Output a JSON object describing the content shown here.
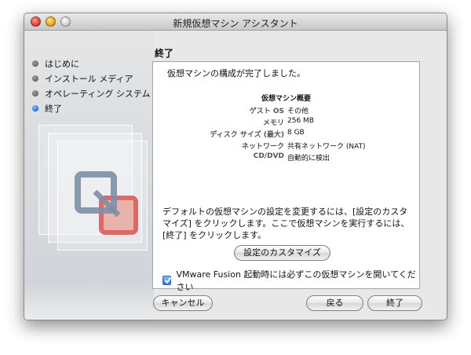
{
  "window": {
    "title": "新規仮想マシン アシスタント"
  },
  "steps": [
    {
      "label": "はじめに",
      "active": false
    },
    {
      "label": "インストール メディア",
      "active": false
    },
    {
      "label": "オペレーティング システム",
      "active": false
    },
    {
      "label": "終了",
      "active": true
    }
  ],
  "page": {
    "title": "終了"
  },
  "panel": {
    "intro": "仮想マシンの構成が完了しました。",
    "summary_title": "仮想マシン概要",
    "summary": [
      {
        "key": "ゲスト OS",
        "value": "その他"
      },
      {
        "key": "メモリ",
        "value": "256 MB"
      },
      {
        "key": "ディスク サイズ (最大)",
        "value": "8 GB"
      },
      {
        "key": "ネットワーク",
        "value": "共有ネットワーク (NAT)"
      },
      {
        "key": "CD/DVD",
        "value": "自動的に検出"
      }
    ],
    "description": "デフォルトの仮想マシンの設定を変更するには、[設定のカスタマイズ] をクリックします。ここで仮想マシンを実行するには、[終了] をクリックします。",
    "customize_label": "設定のカスタマイズ",
    "checkbox_label": "VMware Fusion 起動時には必ずこの仮想マシンを開いてください",
    "checkbox_checked": true
  },
  "buttons": {
    "cancel": "キャンセル",
    "back": "戻る",
    "finish": "終了"
  },
  "icons": {
    "close": "close-icon",
    "minimize": "minimize-icon",
    "zoom": "zoom-icon",
    "logo": "vmware-logo-icon",
    "check": "checkmark-icon"
  },
  "colors": {
    "active_step": "#1d6fd6",
    "checkbox": "#2d7fe0",
    "close": "#e0413a",
    "minimize": "#e8a81d"
  }
}
